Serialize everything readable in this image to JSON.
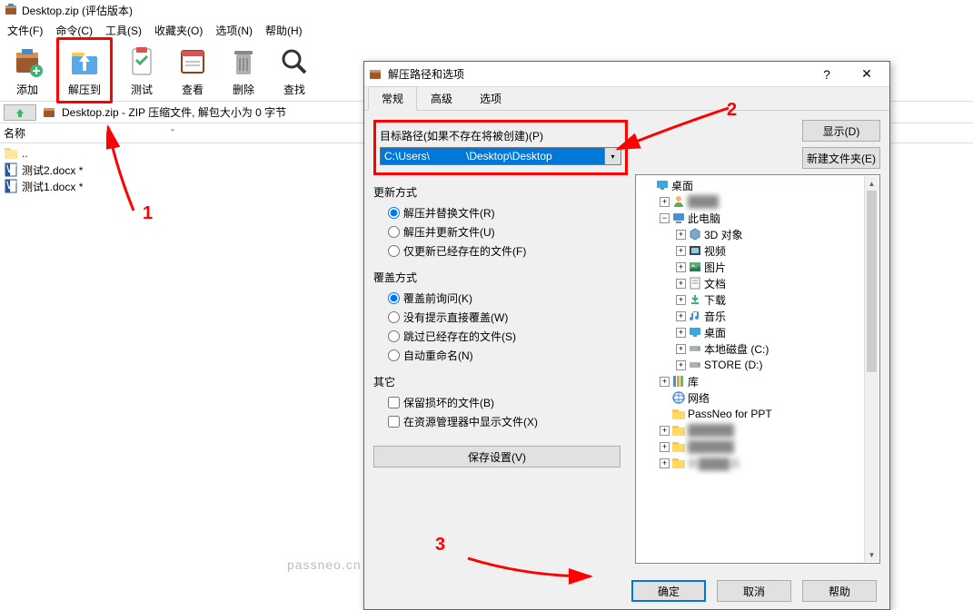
{
  "window": {
    "title": "Desktop.zip (评估版本)"
  },
  "menu": [
    "文件(F)",
    "命令(C)",
    "工具(S)",
    "收藏夹(O)",
    "选项(N)",
    "帮助(H)"
  ],
  "toolbar": [
    {
      "label": "添加",
      "name": "add-button"
    },
    {
      "label": "解压到",
      "name": "extract-to-button",
      "highlight": true
    },
    {
      "label": "测试",
      "name": "test-button"
    },
    {
      "label": "查看",
      "name": "view-button"
    },
    {
      "label": "删除",
      "name": "delete-button"
    },
    {
      "label": "查找",
      "name": "find-button"
    }
  ],
  "path_bar": {
    "text": "Desktop.zip - ZIP 压缩文件, 解包大小为 0 字节"
  },
  "list": {
    "col_name": "名称",
    "sort": "ˇ",
    "rows": [
      {
        "name": "..",
        "icon": "folder-up"
      },
      {
        "name": "测试2.docx *",
        "icon": "docx"
      },
      {
        "name": "测试1.docx *",
        "icon": "docx"
      }
    ]
  },
  "dialog": {
    "title": "解压路径和选项",
    "help_icon": "?",
    "close_icon": "✕",
    "tabs": [
      "常规",
      "高级",
      "选项"
    ],
    "active_tab": 0,
    "path_label": "目标路径(如果不存在将被创建)(P)",
    "path_value": "C:\\Users\\            \\Desktop\\Desktop",
    "btn_show": "显示(D)",
    "btn_newfolder": "新建文件夹(E)",
    "update_title": "更新方式",
    "update_opts": [
      "解压并替换文件(R)",
      "解压并更新文件(U)",
      "仅更新已经存在的文件(F)"
    ],
    "overwrite_title": "覆盖方式",
    "overwrite_opts": [
      "覆盖前询问(K)",
      "没有提示直接覆盖(W)",
      "跳过已经存在的文件(S)",
      "自动重命名(N)"
    ],
    "misc_title": "其它",
    "misc_opts": [
      "保留损坏的文件(B)",
      "在资源管理器中显示文件(X)"
    ],
    "btn_save": "保存设置(V)",
    "tree": [
      {
        "label": "桌面",
        "depth": 0,
        "icon": "desktop",
        "exp": ""
      },
      {
        "label": "████",
        "depth": 1,
        "icon": "user",
        "exp": "+",
        "blur": true
      },
      {
        "label": "此电脑",
        "depth": 1,
        "icon": "pc",
        "exp": "-"
      },
      {
        "label": "3D 对象",
        "depth": 2,
        "icon": "3d",
        "exp": "+"
      },
      {
        "label": "视频",
        "depth": 2,
        "icon": "video",
        "exp": "+"
      },
      {
        "label": "图片",
        "depth": 2,
        "icon": "pic",
        "exp": "+"
      },
      {
        "label": "文档",
        "depth": 2,
        "icon": "doc",
        "exp": "+"
      },
      {
        "label": "下载",
        "depth": 2,
        "icon": "dl",
        "exp": "+"
      },
      {
        "label": "音乐",
        "depth": 2,
        "icon": "music",
        "exp": "+"
      },
      {
        "label": "桌面",
        "depth": 2,
        "icon": "desktop2",
        "exp": "+"
      },
      {
        "label": "本地磁盘 (C:)",
        "depth": 2,
        "icon": "drive",
        "exp": "+"
      },
      {
        "label": "STORE (D:)",
        "depth": 2,
        "icon": "drive",
        "exp": "+"
      },
      {
        "label": "库",
        "depth": 1,
        "icon": "lib",
        "exp": "+"
      },
      {
        "label": "网络",
        "depth": 1,
        "icon": "net",
        "exp": ""
      },
      {
        "label": "PassNeo for PPT",
        "depth": 1,
        "icon": "folder",
        "exp": ""
      },
      {
        "label": "██████",
        "depth": 1,
        "icon": "folder",
        "exp": "+",
        "blur": true
      },
      {
        "label": "██████",
        "depth": 1,
        "icon": "folder",
        "exp": "+",
        "blur": true
      },
      {
        "label": "新████夹",
        "depth": 1,
        "icon": "folder",
        "exp": "+",
        "blur": true
      }
    ],
    "btn_ok": "确定",
    "btn_cancel": "取消",
    "btn_help": "帮助"
  },
  "annotations": {
    "num1": "1",
    "num2": "2",
    "num3": "3"
  },
  "watermark": "passneo.cn"
}
